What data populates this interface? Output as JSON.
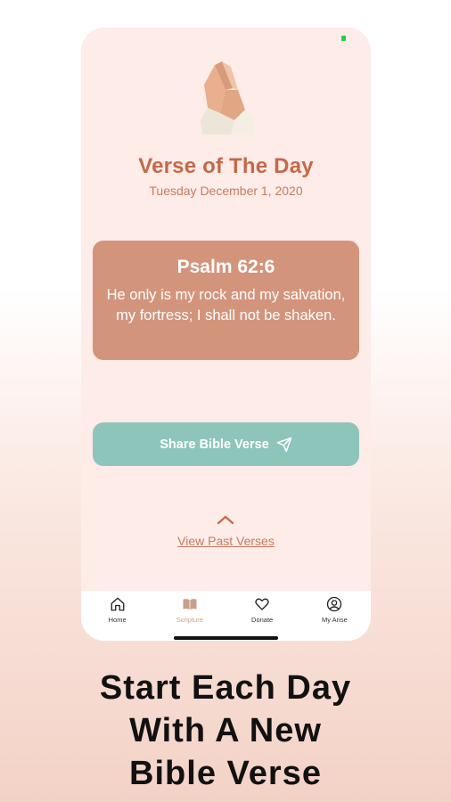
{
  "app": {
    "title": "Verse of The Day",
    "date": "Tuesday December 1, 2020"
  },
  "verse": {
    "reference": "Psalm 62:6",
    "text": "He only is my rock and my salvation, my fortress; I shall not be shaken."
  },
  "share": {
    "label": "Share Bible Verse",
    "icon": "paper-plane-icon"
  },
  "past": {
    "label": "View Past Verses",
    "icon": "chevron-up-icon"
  },
  "tabs": [
    {
      "label": "Home",
      "icon": "home-icon",
      "active": false
    },
    {
      "label": "Scripture",
      "icon": "book-icon",
      "active": true
    },
    {
      "label": "Donate",
      "icon": "heart-icon",
      "active": false
    },
    {
      "label": "My Arise",
      "icon": "user-icon",
      "active": false
    }
  ],
  "caption": {
    "line1": "Start Each Day",
    "line2": "With A New",
    "line3": "Bible Verse"
  },
  "colors": {
    "title": "#c4694a",
    "card": "#d3947c",
    "share_button": "#8ec5bb",
    "screen_bg": "#fdece8",
    "active_tab": "#c9a08b"
  }
}
